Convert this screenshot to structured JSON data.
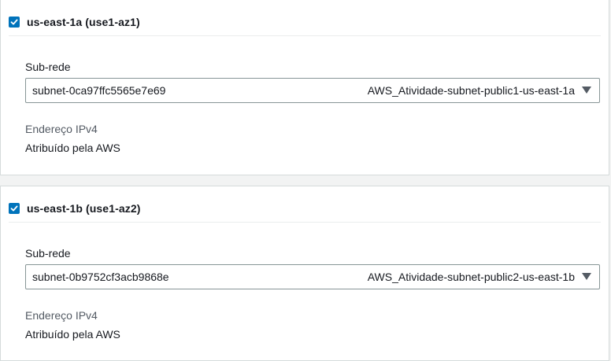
{
  "zones": [
    {
      "title": "us-east-1a (use1-az1)",
      "checked": true,
      "subnet_label": "Sub-rede",
      "subnet_id": "subnet-0ca97ffc5565e7e69",
      "subnet_name": "AWS_Atividade-subnet-public1-us-east-1a",
      "ipv4_label": "Endereço IPv4",
      "ipv4_value": "Atribuído pela AWS"
    },
    {
      "title": "us-east-1b (use1-az2)",
      "checked": true,
      "subnet_label": "Sub-rede",
      "subnet_id": "subnet-0b9752cf3acb9868e",
      "subnet_name": "AWS_Atividade-subnet-public2-us-east-1b",
      "ipv4_label": "Endereço IPv4",
      "ipv4_value": "Atribuído pela AWS"
    }
  ],
  "colors": {
    "checkbox": "#0073bb",
    "card_border": "#d5dbdb",
    "secondary_text": "#545b64"
  },
  "icons": {
    "checkbox": "checkmark-icon",
    "dropdown": "caret-down-icon"
  }
}
